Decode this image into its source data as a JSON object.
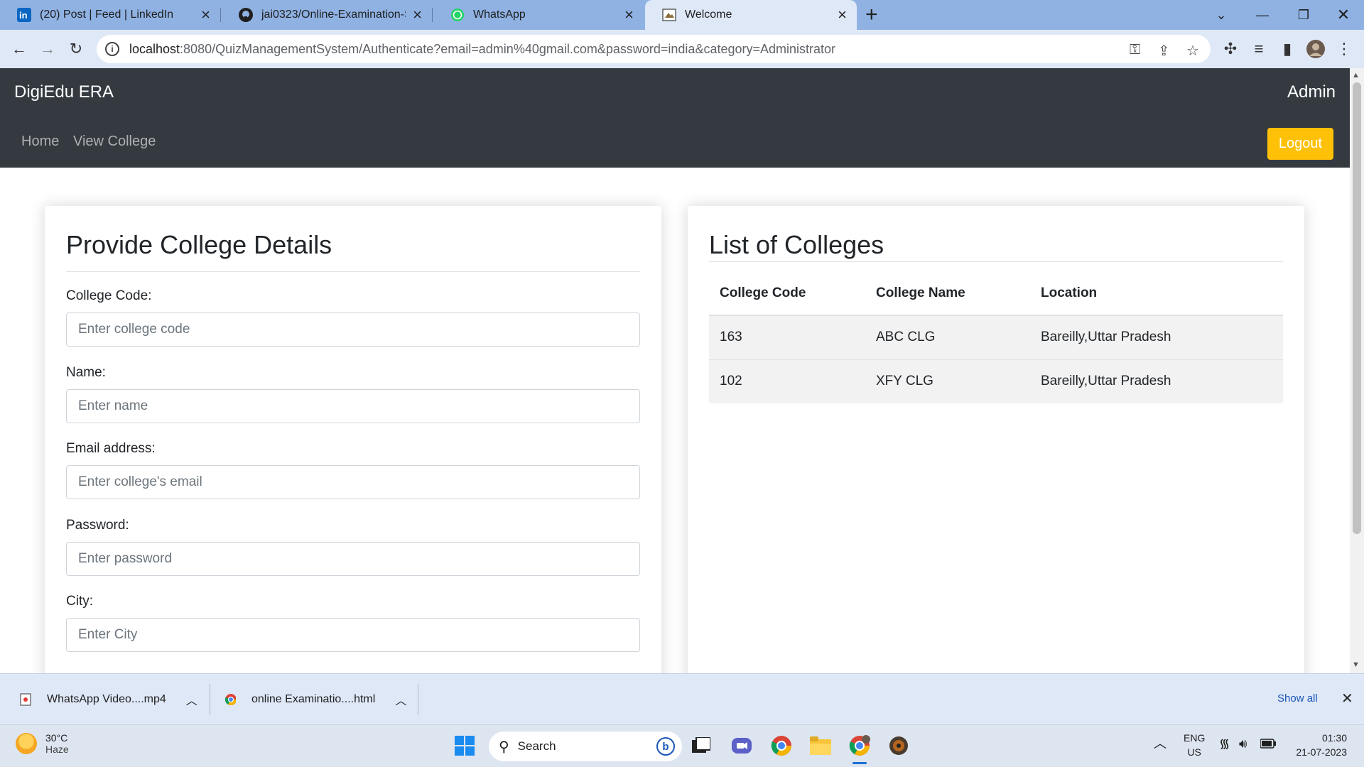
{
  "browser": {
    "tabs": [
      {
        "title": "(20) Post | Feed | LinkedIn",
        "icon": "linkedin-icon"
      },
      {
        "title": "jai0323/Online-Examination-Syst",
        "icon": "github-icon"
      },
      {
        "title": "WhatsApp",
        "icon": "whatsapp-icon"
      },
      {
        "title": "Welcome",
        "icon": "page-icon",
        "active": true
      }
    ],
    "url_host": "localhost",
    "url_rest": ":8080/QuizManagementSystem/Authenticate?email=admin%40gmail.com&password=india&category=Administrator"
  },
  "navbar": {
    "brand": "DigiEdu ERA",
    "user": "Admin",
    "links": [
      "Home",
      "View College"
    ],
    "logout": "Logout"
  },
  "form": {
    "title": "Provide College Details",
    "fields": [
      {
        "label": "College Code:",
        "placeholder": "Enter college code"
      },
      {
        "label": "Name:",
        "placeholder": "Enter name"
      },
      {
        "label": "Email address:",
        "placeholder": "Enter college's email"
      },
      {
        "label": "Password:",
        "placeholder": "Enter password"
      },
      {
        "label": "City:",
        "placeholder": "Enter City"
      }
    ]
  },
  "list": {
    "title": "List of Colleges",
    "columns": [
      "College Code",
      "College Name",
      "Location"
    ],
    "rows": [
      [
        "163",
        "ABC CLG",
        "Bareilly,Uttar Pradesh"
      ],
      [
        "102",
        "XFY CLG",
        "Bareilly,Uttar Pradesh"
      ]
    ]
  },
  "downloads": {
    "items": [
      "WhatsApp Video....mp4",
      "online Examinatio....html"
    ],
    "show_all": "Show all"
  },
  "taskbar": {
    "temp": "30°C",
    "weather": "Haze",
    "search": "Search",
    "lang1": "ENG",
    "lang2": "US",
    "time": "01:30",
    "date": "21-07-2023"
  },
  "colors": {
    "navbar_bg": "#343a40",
    "logout_bg": "#ffc107",
    "tabstrip_bg": "#8fb2e3",
    "toolbar_bg": "#dfe8f7"
  }
}
